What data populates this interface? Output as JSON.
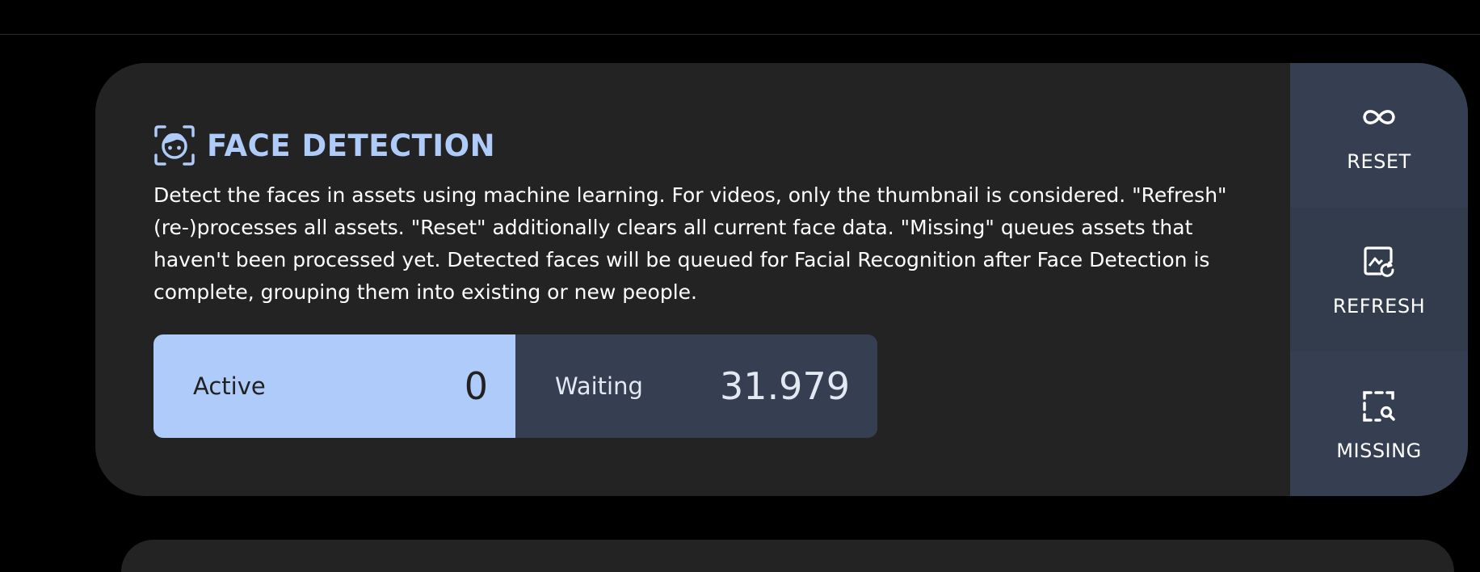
{
  "job": {
    "title": "FACE DETECTION",
    "icon": "face-recognition-icon",
    "description": "Detect the faces in assets using machine learning. For videos, only the thumbnail is considered. \"Refresh\" (re-)processes all assets. \"Reset\" additionally clears all current face data. \"Missing\" queues assets that haven't been processed yet. Detected faces will be queued for Facial Recognition after Face Detection is complete, grouping them into existing or new people.",
    "stats": {
      "active_label": "Active",
      "active_value": "0",
      "waiting_label": "Waiting",
      "waiting_value": "31.979"
    },
    "actions": [
      {
        "label": "RESET",
        "icon": "infinity-icon"
      },
      {
        "label": "REFRESH",
        "icon": "image-refresh-icon"
      },
      {
        "label": "MISSING",
        "icon": "search-missing-icon"
      }
    ]
  },
  "colors": {
    "accent": "#aecbfa",
    "card_bg": "#232323",
    "panel_bg": "#353f51",
    "page_bg": "#000000"
  }
}
